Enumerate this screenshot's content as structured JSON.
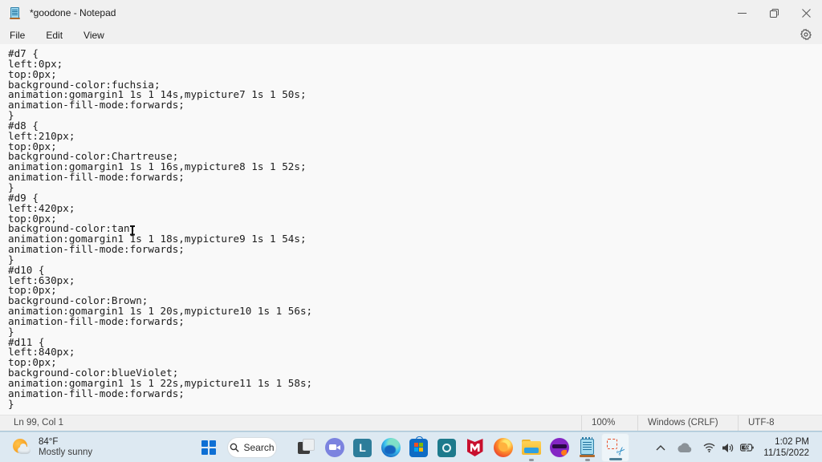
{
  "window": {
    "title": "*goodone - Notepad"
  },
  "menu": {
    "items": [
      "File",
      "Edit",
      "View"
    ]
  },
  "editor": {
    "content": "#d7 {\nleft:0px;\ntop:0px;\nbackground-color:fuchsia;\nanimation:gomargin1 1s 1 14s,mypicture7 1s 1 50s;\nanimation-fill-mode:forwards;\n}\n#d8 {\nleft:210px;\ntop:0px;\nbackground-color:Chartreuse;\nanimation:gomargin1 1s 1 16s,mypicture8 1s 1 52s;\nanimation-fill-mode:forwards;\n}\n#d9 {\nleft:420px;\ntop:0px;\nbackground-color:tan;\nanimation:gomargin1 1s 1 18s,mypicture9 1s 1 54s;\nanimation-fill-mode:forwards;\n}\n#d10 {\nleft:630px;\ntop:0px;\nbackground-color:Brown;\nanimation:gomargin1 1s 1 20s,mypicture10 1s 1 56s;\nanimation-fill-mode:forwards;\n}\n#d11 {\nleft:840px;\ntop:0px;\nbackground-color:blueViolet;\nanimation:gomargin1 1s 1 22s,mypicture11 1s 1 58s;\nanimation-fill-mode:forwards;\n}"
  },
  "status": {
    "position": "Ln 99, Col 1",
    "zoom": "100%",
    "line_ending": "Windows (CRLF)",
    "encoding": "UTF-8"
  },
  "taskbar": {
    "weather": {
      "temperature": "84°F",
      "condition": "Mostly sunny"
    },
    "search": {
      "label": "Search"
    },
    "apps": [
      {
        "name": "task-view"
      },
      {
        "name": "teams-chat"
      },
      {
        "name": "l-app"
      },
      {
        "name": "edge"
      },
      {
        "name": "microsoft-store"
      },
      {
        "name": "circle-app"
      },
      {
        "name": "mcafee"
      },
      {
        "name": "firefox"
      },
      {
        "name": "file-explorer",
        "running": true
      },
      {
        "name": "purple-mask-app"
      },
      {
        "name": "notepad",
        "running": true
      },
      {
        "name": "snipping-tool",
        "active": true
      }
    ],
    "clock": {
      "time": "1:02 PM",
      "date": "11/15/2022"
    }
  },
  "colors": {
    "titlebar_bg": "#f0f0f0",
    "editor_bg": "#f9f9f9",
    "taskbar_bg": "#dde9f2",
    "start_blue": "#0e6fd4",
    "active_underline": "#4e7f97"
  }
}
